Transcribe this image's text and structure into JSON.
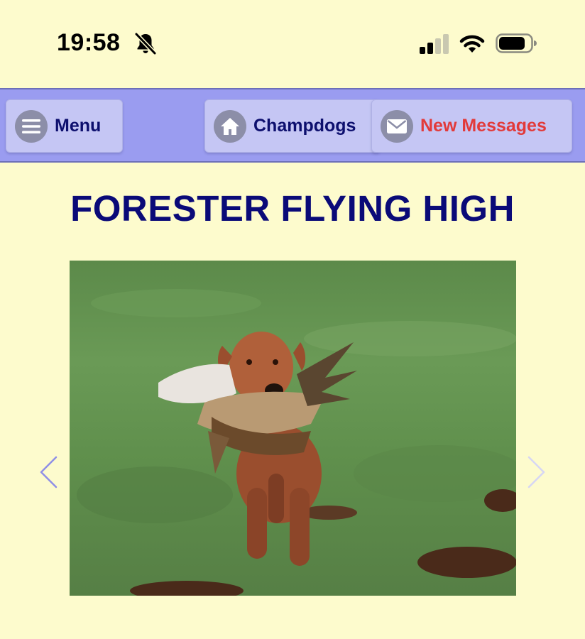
{
  "status_bar": {
    "time": "19:58",
    "icons": [
      "bell-slash-icon",
      "cellular-signal-icon",
      "wifi-icon",
      "battery-icon"
    ]
  },
  "nav": {
    "menu_label": "Menu",
    "home_label": "Champdogs",
    "messages_label": "New Messages",
    "icons": [
      "hamburger-icon",
      "home-icon",
      "envelope-icon"
    ]
  },
  "page": {
    "title": "FORESTER FLYING HIGH"
  },
  "carousel": {
    "icons": [
      "chevron-left-icon",
      "chevron-right-icon"
    ]
  },
  "colors": {
    "background": "#fdfbcd",
    "nav_bar": "#9a9cf0",
    "nav_button": "#c5c6f4",
    "title": "#0a0a78",
    "messages_text": "#e23a3a"
  }
}
